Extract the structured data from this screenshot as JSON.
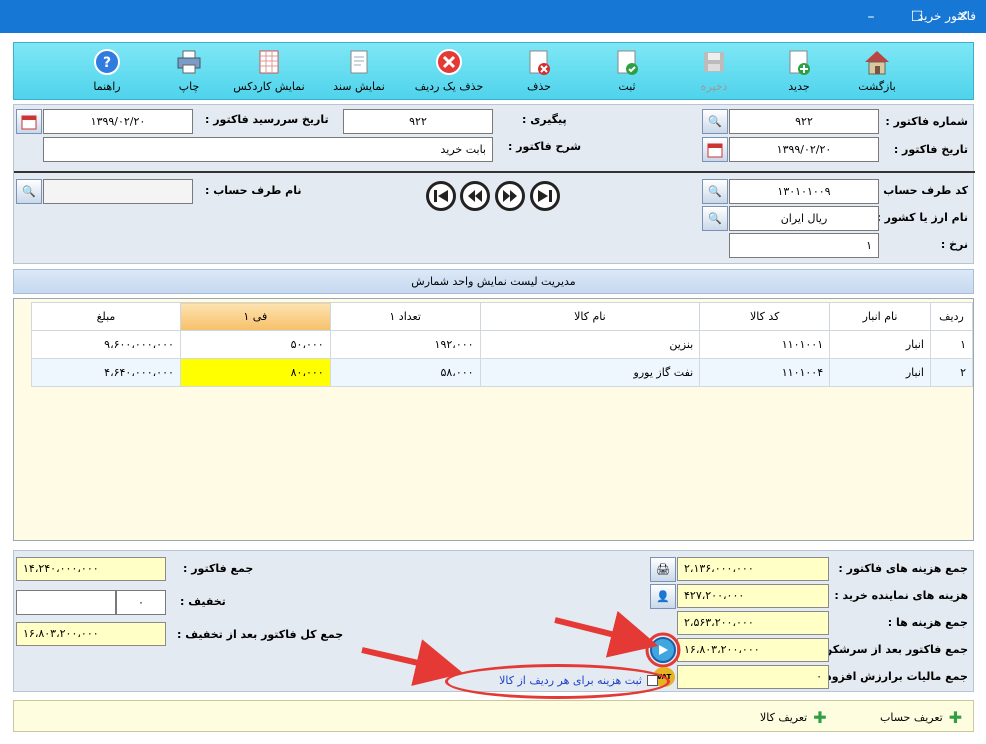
{
  "window": {
    "title": "فاکتور خرید",
    "minimize": "–",
    "maximize": "☐",
    "close": "✕"
  },
  "toolbar": {
    "items": [
      {
        "label": "بازگشت",
        "icon": "home-icon"
      },
      {
        "label": "جدید",
        "icon": "new-document-icon"
      },
      {
        "label": "ذخیره",
        "icon": "save-icon",
        "disabled": true
      },
      {
        "label": "ثبت",
        "icon": "register-icon"
      },
      {
        "label": "حذف",
        "icon": "delete-document-icon"
      },
      {
        "label": "حذف یک ردیف",
        "icon": "delete-row-icon"
      },
      {
        "label": "نمایش سند",
        "icon": "document-icon"
      },
      {
        "label": "نمایش کاردکس",
        "icon": "cardex-icon"
      },
      {
        "label": "چاپ",
        "icon": "printer-icon"
      },
      {
        "label": "راهنما",
        "icon": "help-icon"
      }
    ]
  },
  "header": {
    "invoice_no_label": "شماره فاکتور :",
    "invoice_no": "۹۲۲",
    "invoice_date_label": "تاریخ فاکتور :",
    "invoice_date": "۱۳۹۹/۰۲/۲۰",
    "followup_label": "پیگیری :",
    "followup": "۹۲۲",
    "due_date_label": "تاریخ سررسید فاکتور :",
    "due_date": "۱۳۹۹/۰۲/۲۰",
    "desc_label": "شرح فاکتور :",
    "desc": "بابت خرید",
    "account_code_label": "کد طرف حساب :",
    "account_code": "۱۳۰۱۰۱۰۰۹",
    "currency_label": "نام ارز یا کشور :",
    "currency": "ریال ایران",
    "rate_label": "نرخ :",
    "rate": "۱",
    "account_name_label": "نام طرف حساب :"
  },
  "unit_manager": "مدیریت لیست نمایش واحد شمارش",
  "table": {
    "headers": [
      "ردیف",
      "نام انبار",
      "کد کالا",
      "نام کالا",
      "تعداد ۱",
      "فی ۱",
      "مبلغ"
    ],
    "rows": [
      [
        "۱",
        "انبار",
        "۱۱۰۱۰۰۱",
        "بنزین",
        "۱۹۲،۰۰۰",
        "۵۰،۰۰۰",
        "۹،۶۰۰،۰۰۰،۰۰۰"
      ],
      [
        "۲",
        "انبار",
        "۱۱۰۱۰۰۴",
        "نفت گاز یورو",
        "۵۸،۰۰۰",
        "۸۰،۰۰۰",
        "۴،۶۴۰،۰۰۰،۰۰۰"
      ]
    ]
  },
  "totals": {
    "invoice_costs_label": "جمع هزینه های فاکتور :",
    "invoice_costs": "۲،۱۳۶،۰۰۰،۰۰۰",
    "agent_costs_label": "هزینه های نماینده خرید :",
    "agent_costs": "۴۲۷،۲۰۰،۰۰۰",
    "total_costs_label": "جمع هزینه ها :",
    "total_costs": "۲،۵۶۳،۲۰۰،۰۰۰",
    "after_overhead_label": "جمع فاکتور بعد از سرشکن :",
    "after_overhead": "۱۶،۸۰۳،۲۰۰،۰۰۰",
    "vat_label": "جمع مالیات برارزش افزوده :",
    "vat": "۰",
    "invoice_sum_label": "جمع فاکتور :",
    "invoice_sum": "۱۴،۲۴۰،۰۰۰،۰۰۰",
    "discount_label": "تخفیف :",
    "discount": "۰",
    "grand_total_label": "جمع کل فاکتور بعد از تخفیف :",
    "grand_total": "۱۶،۸۰۳،۲۰۰،۰۰۰",
    "per_row_cost_checkbox": "ثبت هزینه برای هر ردیف از کالا"
  },
  "footer": {
    "define_account": "تعریف حساب",
    "define_item": "تعریف کالا"
  },
  "colors": {
    "titlebar": "#1777d4",
    "toolbar": "#56d6ee",
    "highlight": "#ffff00",
    "annotation": "#e53935"
  }
}
